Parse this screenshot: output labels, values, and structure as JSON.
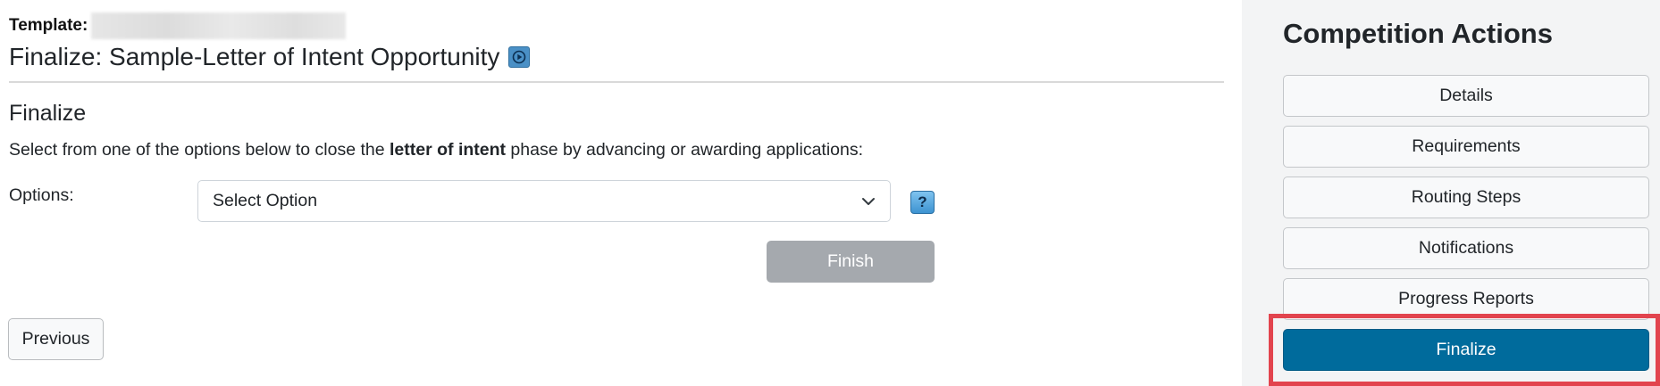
{
  "main": {
    "template_label": "Template:",
    "title": "Finalize: Sample-Letter of Intent Opportunity",
    "section_heading": "Finalize",
    "instruction": {
      "before": "Select from one of the options below to close the ",
      "bold": "letter of intent",
      "after": " phase by advancing or awarding applications:"
    },
    "options_label": "Options:",
    "select_value": "Select Option",
    "help_label": "?",
    "finish_label": "Finish",
    "previous_label": "Previous"
  },
  "sidebar": {
    "title": "Competition Actions",
    "items": [
      {
        "label": "Details"
      },
      {
        "label": "Requirements"
      },
      {
        "label": "Routing Steps"
      },
      {
        "label": "Notifications"
      },
      {
        "label": "Progress Reports"
      },
      {
        "label": "Finalize"
      }
    ],
    "active_item": "Finalize"
  },
  "colors": {
    "active_button": "#006b9c",
    "highlight": "#e2444e",
    "disabled_button": "#a5a9ae",
    "sidebar_bg": "#f3f4f5"
  },
  "icons": {
    "video": "video-play-icon",
    "help": "help-icon",
    "dropdown": "chevron-down-icon"
  }
}
